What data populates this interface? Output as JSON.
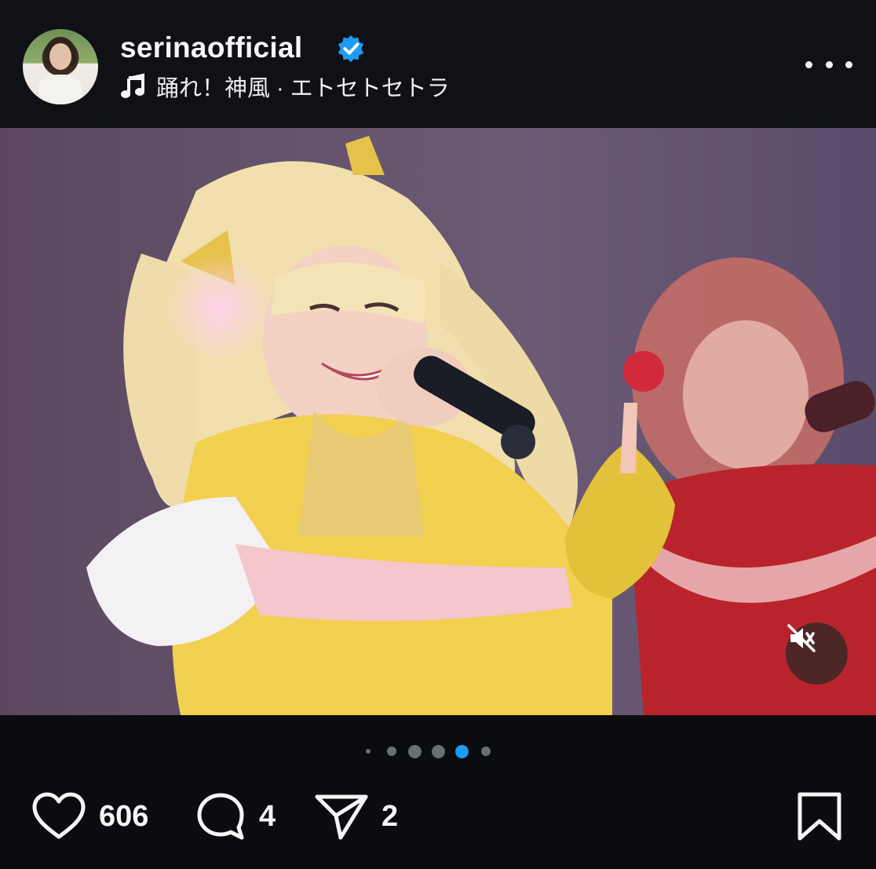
{
  "post": {
    "username": "serinaofficial",
    "verified": true,
    "audio": "踊れ！神風 · エトセトセトラ"
  },
  "carousel": {
    "total_dots": 6,
    "active_index": 4
  },
  "actions": {
    "likes": "606",
    "comments": "4",
    "shares": "2"
  },
  "icons": {
    "verified": "verified-badge-icon",
    "music": "music-note-icon",
    "more": "more-options-icon",
    "mute": "speaker-muted-icon",
    "like": "heart-icon",
    "comment": "comment-bubble-icon",
    "share": "paper-plane-icon",
    "save": "bookmark-icon"
  },
  "colors": {
    "accent": "#1d9bf0",
    "background": "#0b0c10"
  }
}
